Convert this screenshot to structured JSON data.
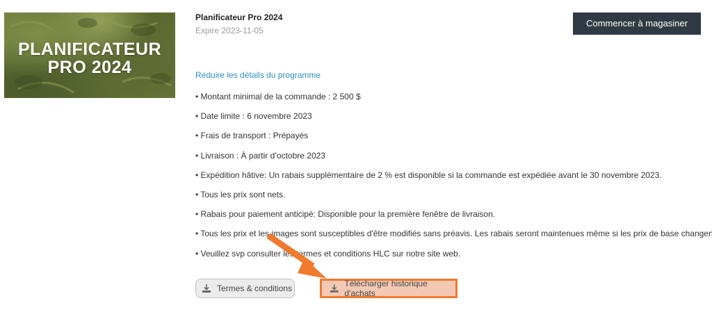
{
  "program": {
    "image_title_line1": "PLANIFICATEUR",
    "image_title_line2": "PRO 2024",
    "name": "Planificateur Pro 2024",
    "expire": "Expire 2023-11-05",
    "shop_button": "Commencer à magasiner",
    "toggle_details": "Réduire les détails du programme"
  },
  "details": [
    "• Montant minimal de la commande : 2 500 $",
    "• Date limite : 6 novembre 2023",
    "• Frais de transport : Prépayés",
    "• Livraison : À partir d’octobre 2023",
    "• Expédition hâtive: Un rabais supplémentaire de 2 % est disponible si la commande est expédiée avant le 30 novembre 2023.",
    "• Tous les prix sont nets.",
    "• Rabais pour paiement anticipé: Disponible pour la première fenêtre de livraison.",
    "• Tous les prix et les images sont susceptibles d'être modifiés sans préavis. Les rabais seront maintenues même si les prix de base changent.",
    "• Veuillez svp consulter les termes et conditions HLC sur notre site web."
  ],
  "buttons": {
    "terms_label": "Termes & conditions",
    "history_label": "Télécharger historique d'achats"
  },
  "icons": {
    "download": "download-icon",
    "annotation_arrow": "arrow-icon"
  },
  "colors": {
    "shop_button_bg": "#2f3a45",
    "link": "#2d8fc6",
    "highlight_border": "#f07a2e",
    "highlight_fill": "#f4c9b4"
  }
}
